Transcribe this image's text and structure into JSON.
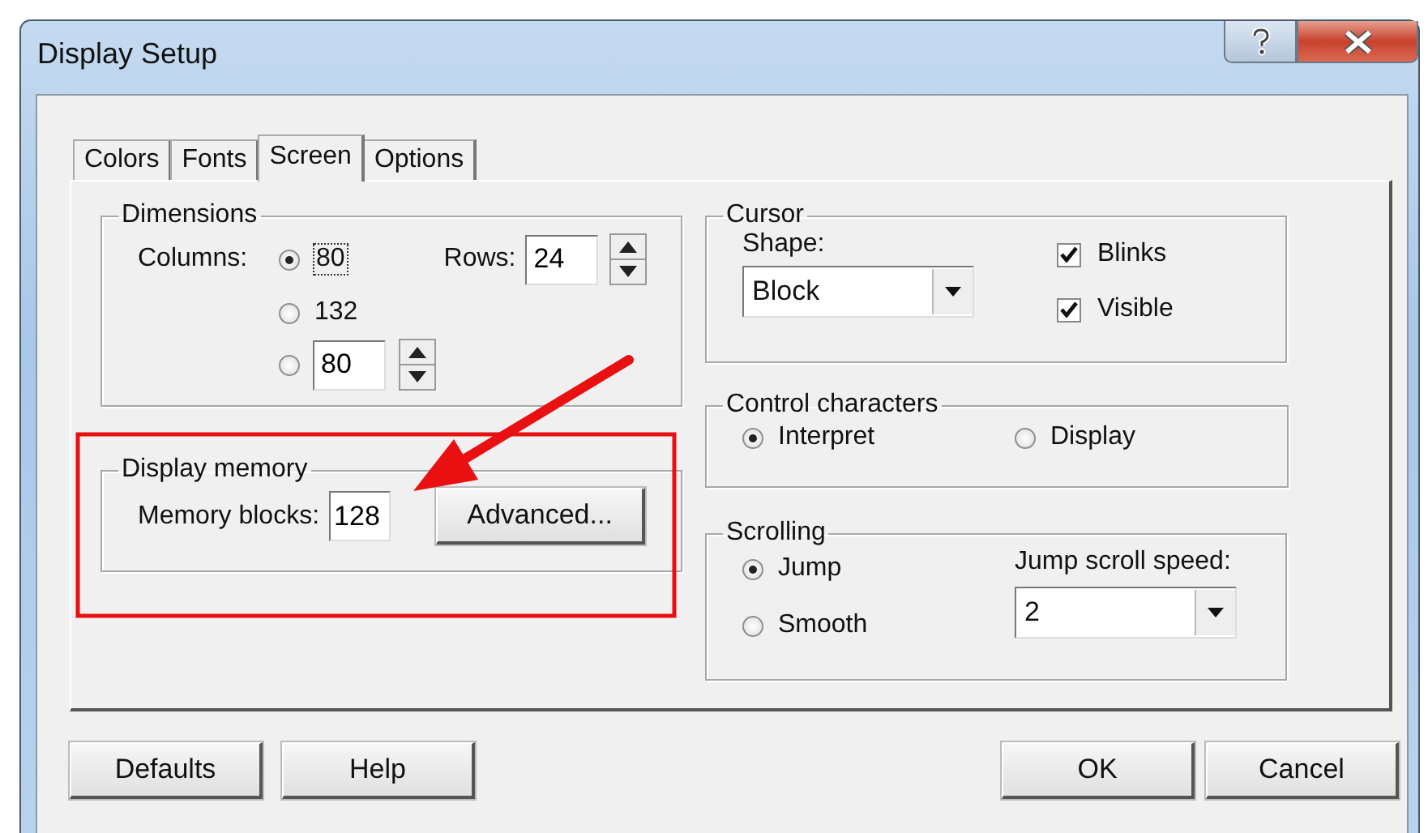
{
  "window": {
    "title": "Display Setup"
  },
  "tabs": [
    {
      "label": "Colors",
      "selected": false
    },
    {
      "label": "Fonts",
      "selected": false
    },
    {
      "label": "Screen",
      "selected": true
    },
    {
      "label": "Options",
      "selected": false
    }
  ],
  "dimensions": {
    "title": "Dimensions",
    "columns_label": "Columns:",
    "rows_label": "Rows:",
    "rows_value": "24",
    "column_options": [
      {
        "kind": "label",
        "label": "80",
        "selected": true
      },
      {
        "kind": "label",
        "label": "132",
        "selected": false
      },
      {
        "kind": "spin",
        "value": "80",
        "selected": false
      }
    ]
  },
  "display_memory": {
    "title": "Display memory",
    "label": "Memory blocks:",
    "value": "128",
    "button": "Advanced..."
  },
  "cursor": {
    "title": "Cursor",
    "shape_label": "Shape:",
    "shape_value": "Block",
    "options": [
      {
        "label": "Blinks",
        "checked": true
      },
      {
        "label": "Visible",
        "checked": true
      }
    ]
  },
  "control_characters": {
    "title": "Control characters",
    "options": [
      {
        "label": "Interpret",
        "selected": true
      },
      {
        "label": "Display",
        "selected": false
      }
    ]
  },
  "scrolling": {
    "title": "Scrolling",
    "speed_label": "Jump scroll speed:",
    "speed_value": "2",
    "options": [
      {
        "label": "Jump",
        "selected": true
      },
      {
        "label": "Smooth",
        "selected": false
      }
    ]
  },
  "left_buttons": [
    "Defaults",
    "Help"
  ],
  "right_buttons": [
    "OK",
    "Cancel"
  ]
}
